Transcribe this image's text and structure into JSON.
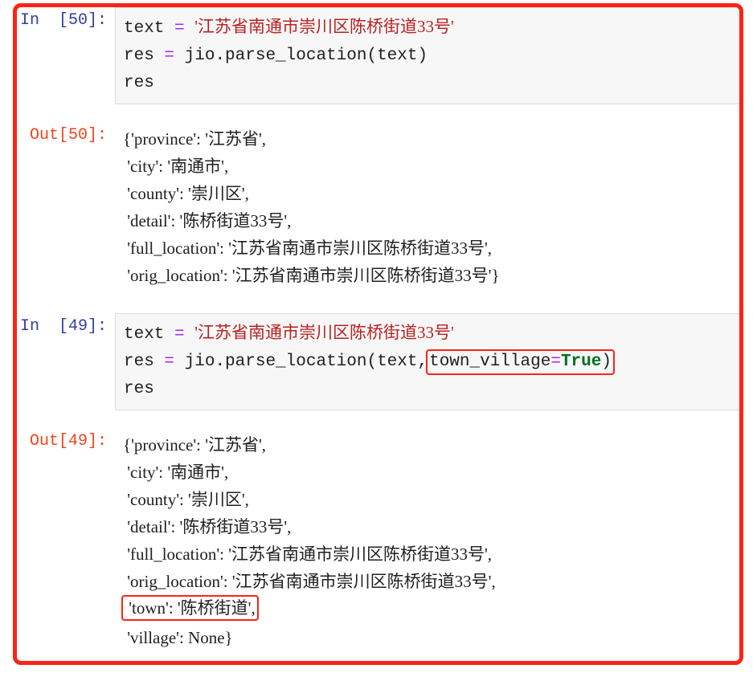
{
  "notebook": {
    "accent_red": "#fa2416",
    "prompt_in_color": "#303f9f",
    "prompt_out_color": "#f4431c",
    "string_color": "#ba2121",
    "operator_color": "#aa22ff",
    "keyword_color": "#007020",
    "cell_background": "#f7f7f7",
    "cells": [
      {
        "type": "input",
        "prompt": "In  [50]:",
        "lines": [
          {
            "segments": [
              {
                "text": "text ",
                "cls": "tok-plain"
              },
              {
                "text": "= ",
                "cls": "tok-op"
              },
              {
                "text": "'江苏省南通市崇川区陈桥街道33号'",
                "cls": "tok-str"
              }
            ]
          },
          {
            "segments": [
              {
                "text": "res ",
                "cls": "tok-plain"
              },
              {
                "text": "= ",
                "cls": "tok-op"
              },
              {
                "text": "jio.parse_location(text)",
                "cls": "tok-plain"
              }
            ]
          },
          {
            "segments": [
              {
                "text": "res",
                "cls": "tok-plain"
              }
            ]
          }
        ]
      },
      {
        "type": "output",
        "prompt": "Out[50]:",
        "lines": [
          "{'province': '江苏省',",
          " 'city': '南通市',",
          " 'county': '崇川区',",
          " 'detail': '陈桥街道33号',",
          " 'full_location': '江苏省南通市崇川区陈桥街道33号',",
          " 'orig_location': '江苏省南通市崇川区陈桥街道33号'}"
        ]
      },
      {
        "type": "input",
        "prompt": "In  [49]:",
        "lines": [
          {
            "segments": [
              {
                "text": "text ",
                "cls": "tok-plain"
              },
              {
                "text": "= ",
                "cls": "tok-op"
              },
              {
                "text": "'江苏省南通市崇川区陈桥街道33号'",
                "cls": "tok-str"
              }
            ]
          },
          {
            "segments": [
              {
                "text": "res ",
                "cls": "tok-plain"
              },
              {
                "text": "= ",
                "cls": "tok-op"
              },
              {
                "text": "jio.parse_location(text,",
                "cls": "tok-plain"
              },
              {
                "text": "town_village",
                "cls": "tok-plain",
                "boxed_start": true
              },
              {
                "text": "=",
                "cls": "tok-op"
              },
              {
                "text": "True",
                "cls": "tok-kw"
              },
              {
                "text": ")",
                "cls": "tok-plain",
                "boxed_end": true
              }
            ]
          },
          {
            "segments": [
              {
                "text": "res",
                "cls": "tok-plain"
              }
            ]
          }
        ]
      },
      {
        "type": "output",
        "prompt": "Out[49]:",
        "lines": [
          "{'province': '江苏省',",
          " 'city': '南通市',",
          " 'county': '崇川区',",
          " 'detail': '陈桥街道33号',",
          " 'full_location': '江苏省南通市崇川区陈桥街道33号',",
          " 'orig_location': '江苏省南通市崇川区陈桥街道33号',",
          " 'town': '陈桥街道',",
          " 'village': None}"
        ],
        "highlight_line_index": 6
      }
    ]
  }
}
